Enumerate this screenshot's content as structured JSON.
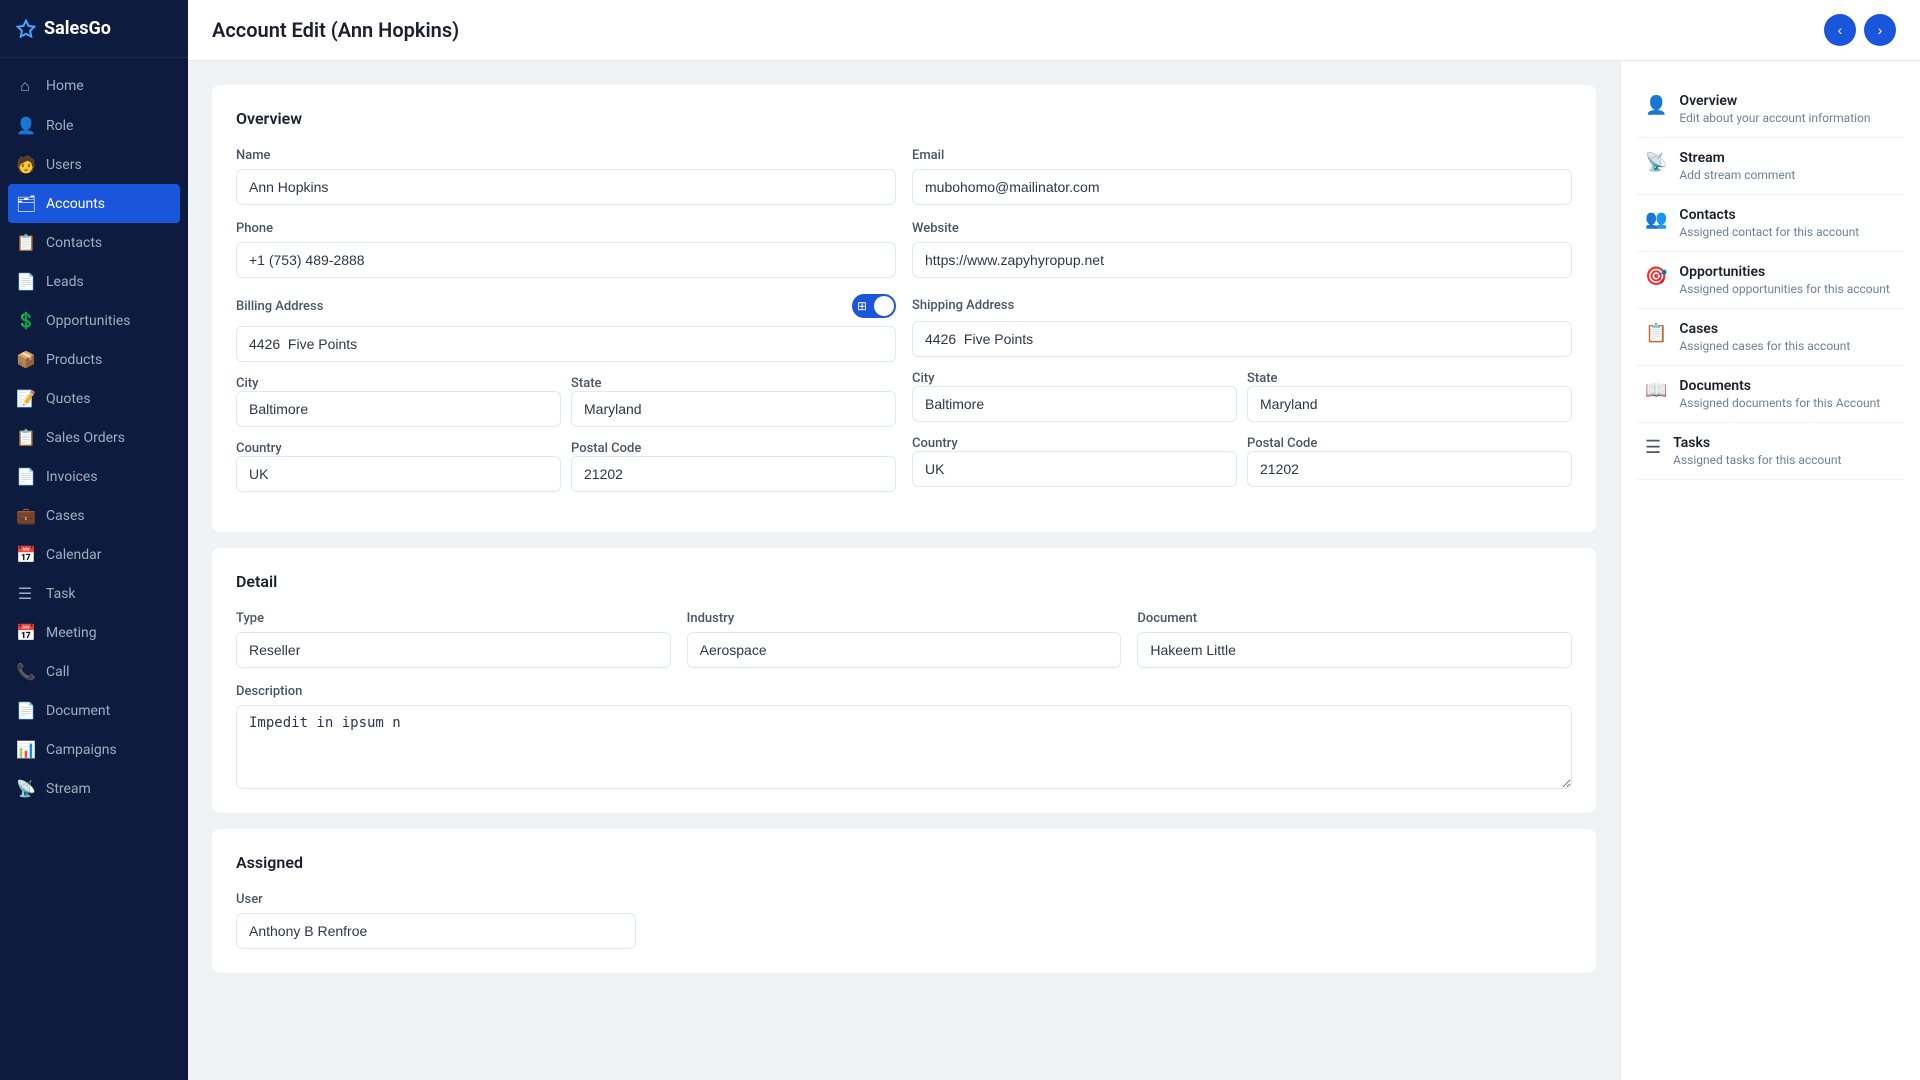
{
  "sidebar": {
    "logo": "SalesGo",
    "items": [
      {
        "id": "home",
        "label": "Home",
        "icon": "⌂"
      },
      {
        "id": "role",
        "label": "Role",
        "icon": "👤"
      },
      {
        "id": "users",
        "label": "Users",
        "icon": "🧑"
      },
      {
        "id": "accounts",
        "label": "Accounts",
        "icon": "🗂",
        "active": true
      },
      {
        "id": "contacts",
        "label": "Contacts",
        "icon": "📋"
      },
      {
        "id": "leads",
        "label": "Leads",
        "icon": "📄"
      },
      {
        "id": "opportunities",
        "label": "Opportunities",
        "icon": "💲"
      },
      {
        "id": "products",
        "label": "Products",
        "icon": "📦"
      },
      {
        "id": "quotes",
        "label": "Quotes",
        "icon": "📝"
      },
      {
        "id": "sales-orders",
        "label": "Sales Orders",
        "icon": "📋"
      },
      {
        "id": "invoices",
        "label": "Invoices",
        "icon": "📄"
      },
      {
        "id": "cases",
        "label": "Cases",
        "icon": "💼"
      },
      {
        "id": "calendar",
        "label": "Calendar",
        "icon": "📅"
      },
      {
        "id": "task",
        "label": "Task",
        "icon": "☰"
      },
      {
        "id": "meeting",
        "label": "Meeting",
        "icon": "📅"
      },
      {
        "id": "call",
        "label": "Call",
        "icon": "📞"
      },
      {
        "id": "document",
        "label": "Document",
        "icon": "📄"
      },
      {
        "id": "campaigns",
        "label": "Campaigns",
        "icon": "📊"
      },
      {
        "id": "stream",
        "label": "Stream",
        "icon": "📡"
      }
    ]
  },
  "page": {
    "title": "Account Edit (Ann Hopkins)"
  },
  "overview_section": {
    "title": "Overview",
    "name_label": "Name",
    "name_value": "Ann Hopkins",
    "email_label": "Email",
    "email_value": "mubohomo@mailinator.com",
    "phone_label": "Phone",
    "phone_value": "+1 (753) 489-2888",
    "website_label": "Website",
    "website_value": "https://www.zapyhyropup.net",
    "billing_address_label": "Billing Address",
    "billing_address_value": "4426  Five Points",
    "shipping_address_label": "Shipping Address",
    "shipping_address_value": "4426  Five Points",
    "billing_city": "Baltimore",
    "billing_state": "Maryland",
    "billing_country": "UK",
    "billing_postal": "21202",
    "shipping_city": "Baltimore",
    "shipping_state": "Maryland",
    "shipping_country": "UK",
    "shipping_postal": "21202",
    "city_label": "City",
    "state_label": "State",
    "country_label": "Country",
    "postal_label": "Postal Code"
  },
  "detail_section": {
    "title": "Detail",
    "type_label": "Type",
    "type_value": "Reseller",
    "industry_label": "Industry",
    "industry_value": "Aerospace",
    "document_label": "Document",
    "document_value": "Hakeem Little",
    "description_label": "Description",
    "description_value": "Impedit in ipsum n"
  },
  "assigned_section": {
    "title": "Assigned",
    "user_label": "User",
    "user_value": "Anthony B Renfroe"
  },
  "right_sidebar": {
    "items": [
      {
        "id": "overview",
        "icon": "👤",
        "title": "Overview",
        "subtitle": "Edit about your account information"
      },
      {
        "id": "stream",
        "icon": "📡",
        "title": "Stream",
        "subtitle": "Add stream comment"
      },
      {
        "id": "contacts",
        "icon": "👥",
        "title": "Contacts",
        "subtitle": "Assigned contact for this account"
      },
      {
        "id": "opportunities",
        "icon": "🎯",
        "title": "Opportunities",
        "subtitle": "Assigned opportunities for this account"
      },
      {
        "id": "cases",
        "icon": "📋",
        "title": "Cases",
        "subtitle": "Assigned cases for this account"
      },
      {
        "id": "documents",
        "icon": "📖",
        "title": "Documents",
        "subtitle": "Assigned documents for this Account"
      },
      {
        "id": "tasks",
        "icon": "☰",
        "title": "Tasks",
        "subtitle": "Assigned tasks for this account"
      }
    ]
  }
}
